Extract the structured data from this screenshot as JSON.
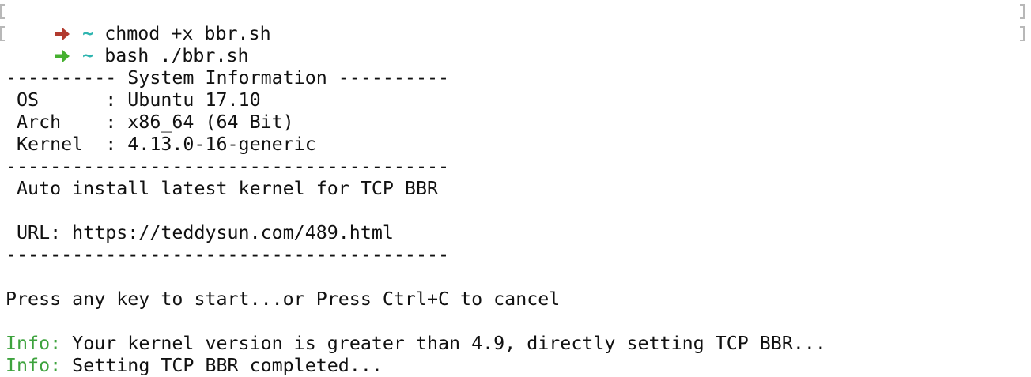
{
  "terminal": {
    "prompt1": {
      "arrow_color": "#b23a2e",
      "tilde": "~",
      "tilde_color": "#2fb5b0",
      "command": "chmod +x bbr.sh"
    },
    "prompt2": {
      "arrow_color": "#45b02f",
      "tilde": "~",
      "tilde_color": "#2fb5b0",
      "command": "bash ./bbr.sh"
    },
    "sysinfo_header": "---------- System Information ----------",
    "os_line": " OS      : Ubuntu 17.10",
    "arch_line": " Arch    : x86_64 (64 Bit)",
    "kernel_line": " Kernel  : 4.13.0-16-generic",
    "separator": "----------------------------------------",
    "auto_line": " Auto install latest kernel for TCP BBR",
    "url_line": " URL: https://teddysun.com/489.html",
    "press_line": "Press any key to start...or Press Ctrl+C to cancel",
    "info1_label": "Info:",
    "info1_text": " Your kernel version is greater than 4.9, directly setting TCP BBR...",
    "info2_label": "Info:",
    "info2_text": " Setting TCP BBR completed...",
    "info_color": "#3ea33e"
  }
}
